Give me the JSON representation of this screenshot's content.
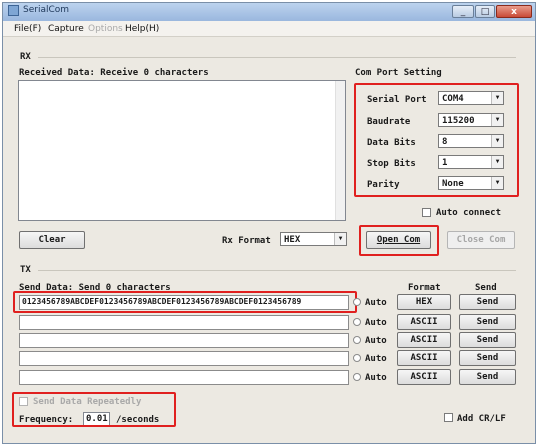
{
  "window": {
    "title": "SerialCom",
    "controls": [
      "_",
      "□",
      "x"
    ]
  },
  "menu": {
    "items": [
      "File(F)",
      "Capture",
      "Options",
      "Help(H)"
    ]
  },
  "rx": {
    "section_label": "RX",
    "received_label": "Received Data: Receive 0 characters",
    "clear_label": "Clear",
    "rx_format_label": "Rx Format",
    "rx_format_value": "HEX"
  },
  "port": {
    "section_label": "Com Port Setting",
    "serial_port_label": "Serial Port",
    "serial_port_value": "COM4",
    "baudrate_label": "Baudrate",
    "baudrate_value": "115200",
    "data_bits_label": "Data Bits",
    "data_bits_value": "8",
    "stop_bits_label": "Stop Bits",
    "stop_bits_value": "1",
    "parity_label": "Parity",
    "parity_value": "None",
    "auto_connect_label": "Auto connect",
    "open_label": "Open Com",
    "close_label": "Close Com"
  },
  "tx": {
    "section_label": "TX",
    "send_label": "Send Data: Send 0 characters",
    "format_header": "Format",
    "send_header": "Send",
    "rows": [
      {
        "text": "0123456789ABCDEF0123456789ABCDEF0123456789ABCDEF0123456789",
        "auto": "Auto",
        "format": "HEX",
        "send": "Send"
      },
      {
        "text": "",
        "auto": "Auto",
        "format": "ASCII",
        "send": "Send"
      },
      {
        "text": "",
        "auto": "Auto",
        "format": "ASCII",
        "send": "Send"
      },
      {
        "text": "",
        "auto": "Auto",
        "format": "ASCII",
        "send": "Send"
      },
      {
        "text": "",
        "auto": "Auto",
        "format": "ASCII",
        "send": "Send"
      }
    ],
    "repeat_label": "Send Data Repeatedly",
    "frequency_label": "Frequency:",
    "frequency_value": "0.01",
    "frequency_unit": "/seconds",
    "add_crlf_label": "Add CR/LF"
  }
}
